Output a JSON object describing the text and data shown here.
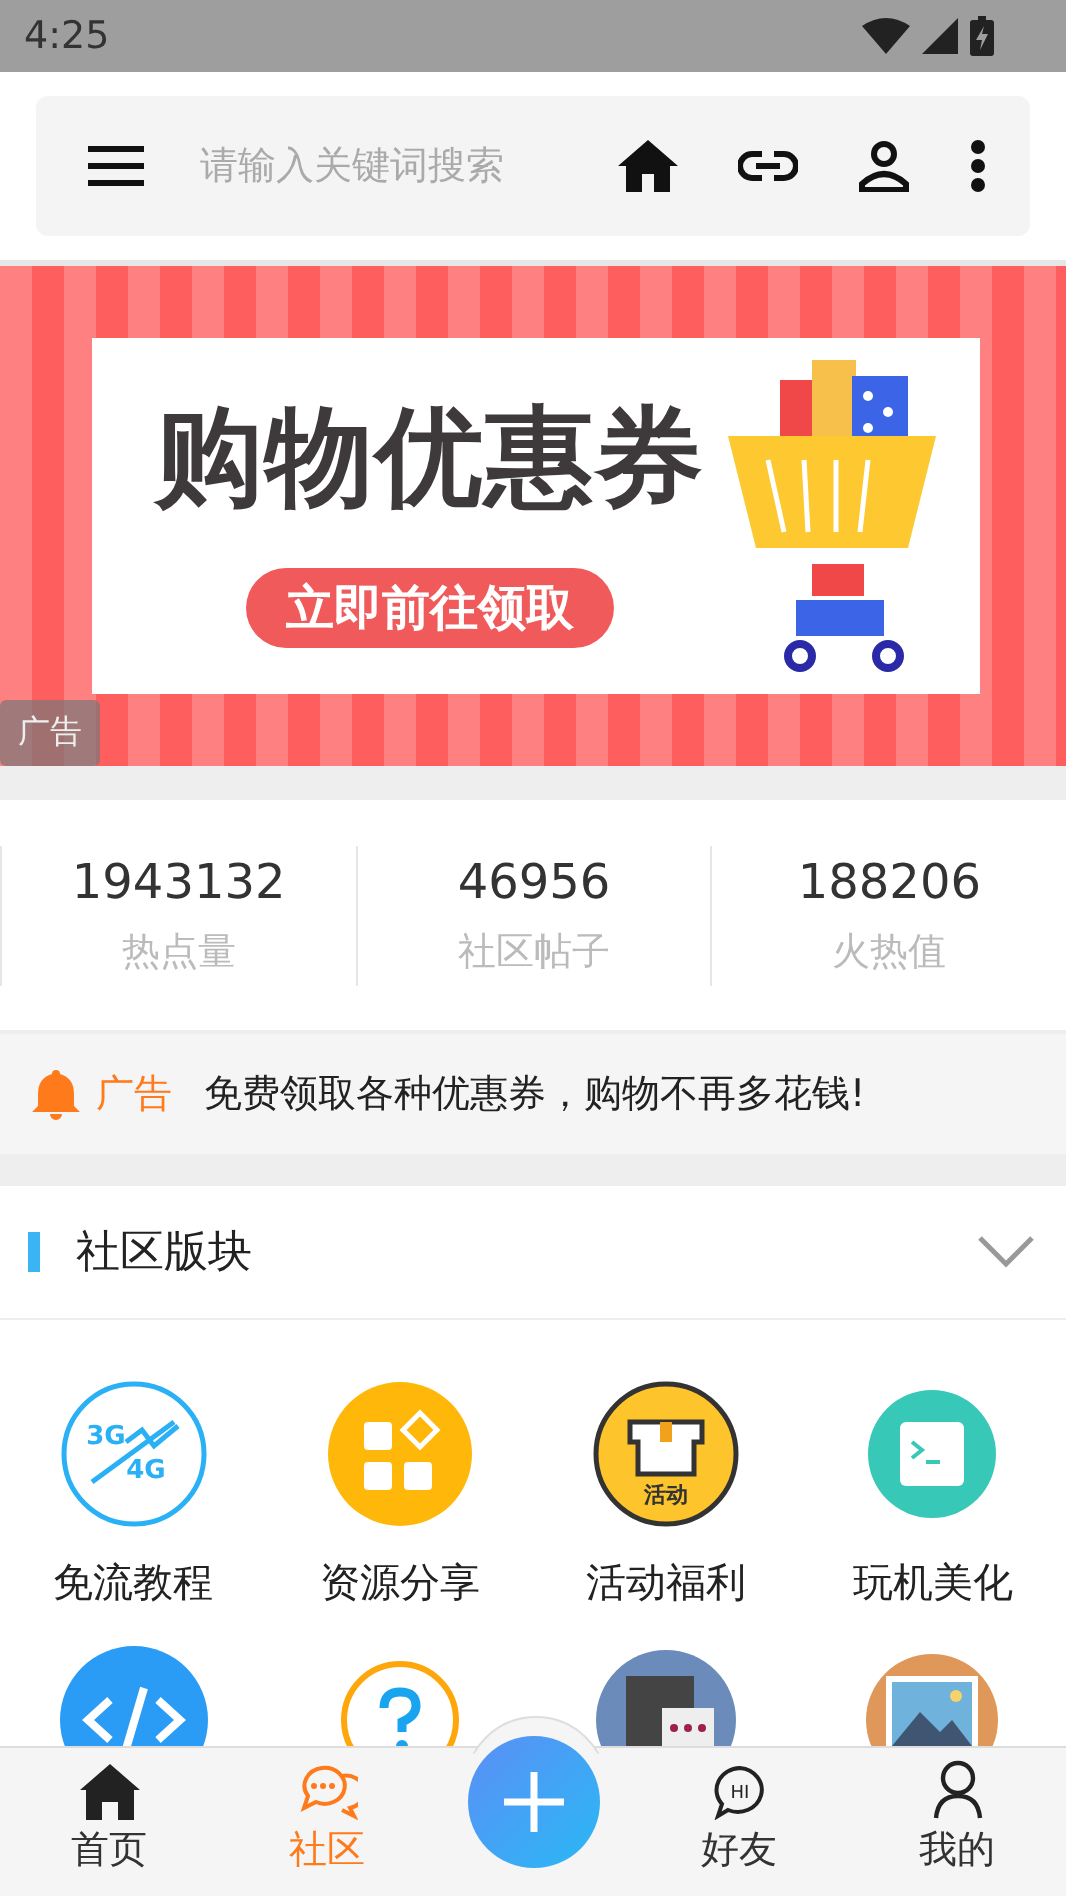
{
  "status_bar": {
    "time": "4:25"
  },
  "search": {
    "placeholder": "请输入关键词搜索"
  },
  "banner": {
    "headline": "购物优惠券",
    "cta": "立即前往领取",
    "ad_badge": "广告"
  },
  "stats": [
    {
      "value": "1943132",
      "label": "热点量"
    },
    {
      "value": "46956",
      "label": "社区帖子"
    },
    {
      "value": "188206",
      "label": "火热值"
    }
  ],
  "notice": {
    "tag": "广告",
    "text": "免费领取各种优惠券，购物不再多花钱!"
  },
  "section": {
    "title": "社区版块"
  },
  "categories": [
    {
      "kind": "network",
      "label": "免流教程",
      "icon_text": [
        "3G",
        "4G"
      ]
    },
    {
      "kind": "apps",
      "label": "资源分享"
    },
    {
      "kind": "gift",
      "label": "活动福利",
      "icon_text": [
        "活动"
      ]
    },
    {
      "kind": "terminal",
      "label": "玩机美化"
    },
    {
      "kind": "code"
    },
    {
      "kind": "question"
    },
    {
      "kind": "chatroom"
    },
    {
      "kind": "image"
    }
  ],
  "bottom_nav": [
    {
      "kind": "home",
      "label": "首页",
      "selected": false
    },
    {
      "kind": "chat",
      "label": "社区",
      "selected": true
    },
    {
      "kind": "fab"
    },
    {
      "kind": "hi",
      "label": "好友",
      "selected": false,
      "icon_text": [
        "HI"
      ]
    },
    {
      "kind": "person",
      "label": "我的",
      "selected": false
    }
  ]
}
